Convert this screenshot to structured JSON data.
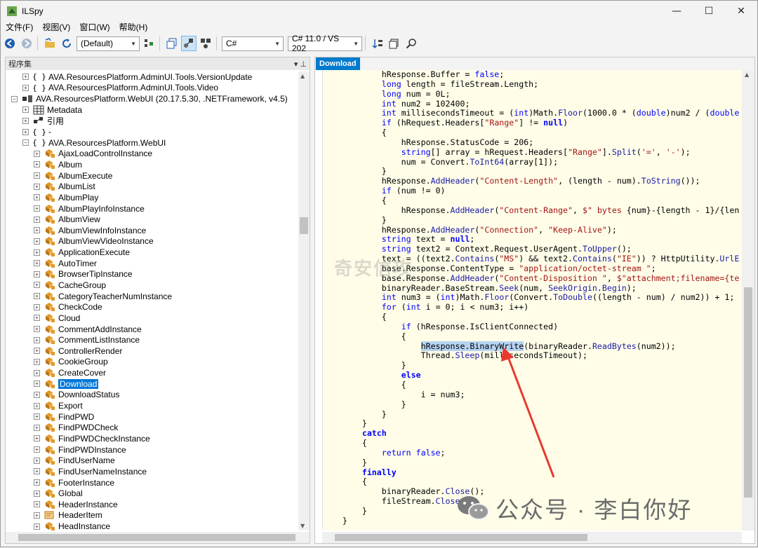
{
  "window": {
    "title": "ILSpy",
    "controls": [
      "—",
      "☐",
      "✕"
    ]
  },
  "menu": [
    "文件(F)",
    "视图(V)",
    "窗口(W)",
    "帮助(H)"
  ],
  "toolbar": {
    "assembly_list": "(Default)",
    "language": "C#",
    "version": "C# 11.0 / VS 202"
  },
  "left_pane": {
    "header": "程序集",
    "pin": "▾ ⊥"
  },
  "tree": [
    {
      "indent": 1,
      "expander": "+",
      "icon": "ns",
      "label": "AVA.ResourcesPlatform.AdminUI.Tools.VersionUpdate"
    },
    {
      "indent": 1,
      "expander": "+",
      "icon": "ns",
      "label": "AVA.ResourcesPlatform.AdminUI.Tools.Video"
    },
    {
      "indent": 0,
      "expander": "−",
      "icon": "asm",
      "label": "AVA.ResourcesPlatform.WebUI (20.17.5.30, .NETFramework, v4.5)"
    },
    {
      "indent": 1,
      "expander": "+",
      "icon": "meta",
      "label": "Metadata"
    },
    {
      "indent": 1,
      "expander": "+",
      "icon": "ref",
      "label": "引用"
    },
    {
      "indent": 1,
      "expander": "+",
      "icon": "ns",
      "label": "-"
    },
    {
      "indent": 1,
      "expander": "−",
      "icon": "ns",
      "label": "AVA.ResourcesPlatform.WebUI"
    },
    {
      "indent": 2,
      "expander": "+",
      "icon": "cls",
      "label": "AjaxLoadControlInstance"
    },
    {
      "indent": 2,
      "expander": "+",
      "icon": "cls",
      "label": "Album"
    },
    {
      "indent": 2,
      "expander": "+",
      "icon": "cls",
      "label": "AlbumExecute"
    },
    {
      "indent": 2,
      "expander": "+",
      "icon": "cls",
      "label": "AlbumList"
    },
    {
      "indent": 2,
      "expander": "+",
      "icon": "cls",
      "label": "AlbumPlay"
    },
    {
      "indent": 2,
      "expander": "+",
      "icon": "cls",
      "label": "AlbumPlayInfoInstance"
    },
    {
      "indent": 2,
      "expander": "+",
      "icon": "cls",
      "label": "AlbumView"
    },
    {
      "indent": 2,
      "expander": "+",
      "icon": "cls",
      "label": "AlbumViewInfoInstance"
    },
    {
      "indent": 2,
      "expander": "+",
      "icon": "cls",
      "label": "AlbumViewVideoInstance"
    },
    {
      "indent": 2,
      "expander": "+",
      "icon": "cls",
      "label": "ApplicationExecute"
    },
    {
      "indent": 2,
      "expander": "+",
      "icon": "cls",
      "label": "AutoTimer"
    },
    {
      "indent": 2,
      "expander": "+",
      "icon": "cls",
      "label": "BrowserTipInstance"
    },
    {
      "indent": 2,
      "expander": "+",
      "icon": "cls",
      "label": "CacheGroup"
    },
    {
      "indent": 2,
      "expander": "+",
      "icon": "cls",
      "label": "CategoryTeacherNumInstance"
    },
    {
      "indent": 2,
      "expander": "+",
      "icon": "cls",
      "label": "CheckCode"
    },
    {
      "indent": 2,
      "expander": "+",
      "icon": "cls",
      "label": "Cloud"
    },
    {
      "indent": 2,
      "expander": "+",
      "icon": "cls",
      "label": "CommentAddInstance"
    },
    {
      "indent": 2,
      "expander": "+",
      "icon": "cls",
      "label": "CommentListInstance"
    },
    {
      "indent": 2,
      "expander": "+",
      "icon": "cls",
      "label": "ControllerRender"
    },
    {
      "indent": 2,
      "expander": "+",
      "icon": "cls",
      "label": "CookieGroup"
    },
    {
      "indent": 2,
      "expander": "+",
      "icon": "cls",
      "label": "CreateCover"
    },
    {
      "indent": 2,
      "expander": "+",
      "icon": "cls",
      "label": "Download",
      "selected": true
    },
    {
      "indent": 2,
      "expander": "+",
      "icon": "cls",
      "label": "DownloadStatus"
    },
    {
      "indent": 2,
      "expander": "+",
      "icon": "cls",
      "label": "Export"
    },
    {
      "indent": 2,
      "expander": "+",
      "icon": "cls",
      "label": "FindPWD"
    },
    {
      "indent": 2,
      "expander": "+",
      "icon": "cls",
      "label": "FindPWDCheck"
    },
    {
      "indent": 2,
      "expander": "+",
      "icon": "cls",
      "label": "FindPWDCheckInstance"
    },
    {
      "indent": 2,
      "expander": "+",
      "icon": "cls",
      "label": "FindPWDInstance"
    },
    {
      "indent": 2,
      "expander": "+",
      "icon": "cls",
      "label": "FindUserName"
    },
    {
      "indent": 2,
      "expander": "+",
      "icon": "cls",
      "label": "FindUserNameInstance"
    },
    {
      "indent": 2,
      "expander": "+",
      "icon": "cls",
      "label": "FooterInstance"
    },
    {
      "indent": 2,
      "expander": "+",
      "icon": "cls",
      "label": "Global"
    },
    {
      "indent": 2,
      "expander": "+",
      "icon": "cls",
      "label": "HeaderInstance"
    },
    {
      "indent": 2,
      "expander": "+",
      "icon": "item",
      "label": "HeaderItem"
    },
    {
      "indent": 2,
      "expander": "+",
      "icon": "cls",
      "label": "HeadInstance"
    }
  ],
  "editor": {
    "tab": "Download",
    "lines": [
      [
        [
          "            hResponse.Buffer = ",
          ""
        ],
        [
          "false",
          "kw"
        ],
        [
          ";",
          ""
        ]
      ],
      [
        [
          "            ",
          ""
        ],
        [
          "long",
          "kw"
        ],
        [
          " length = fileStream.Length;",
          ""
        ]
      ],
      [
        [
          "            ",
          ""
        ],
        [
          "long",
          "kw"
        ],
        [
          " num = 0L;",
          ""
        ]
      ],
      [
        [
          "            ",
          ""
        ],
        [
          "int",
          "kw"
        ],
        [
          " num2 = 102400;",
          ""
        ]
      ],
      [
        [
          "            ",
          ""
        ],
        [
          "int",
          "kw"
        ],
        [
          " millisecondsTimeout = (",
          ""
        ],
        [
          "int",
          "kw"
        ],
        [
          ")Math.",
          ""
        ],
        [
          "Floor",
          "mth"
        ],
        [
          "(1000.0 * (",
          ""
        ],
        [
          "double",
          "kw"
        ],
        [
          ")num2 / (",
          ""
        ],
        [
          "double",
          "kw"
        ]
      ],
      [
        [
          "            ",
          ""
        ],
        [
          "if",
          "kw"
        ],
        [
          " (hRequest.Headers[",
          ""
        ],
        [
          "\"Range\"",
          "str"
        ],
        [
          "] != ",
          ""
        ],
        [
          "null",
          "kwb"
        ],
        [
          ")",
          ""
        ]
      ],
      [
        [
          "            {",
          ""
        ]
      ],
      [
        [
          "                hResponse.StatusCode = 206;",
          ""
        ]
      ],
      [
        [
          "                ",
          ""
        ],
        [
          "string",
          "kw"
        ],
        [
          "[] array = hRequest.Headers[",
          ""
        ],
        [
          "\"Range\"",
          "str"
        ],
        [
          "].",
          ""
        ],
        [
          "Split",
          "mth"
        ],
        [
          "(",
          ""
        ],
        [
          "'='",
          "str"
        ],
        [
          ", ",
          ""
        ],
        [
          "'-'",
          "str"
        ],
        [
          ");",
          ""
        ]
      ],
      [
        [
          "                num = Convert.",
          ""
        ],
        [
          "ToInt64",
          "mth"
        ],
        [
          "(array[1]);",
          ""
        ]
      ],
      [
        [
          "            }",
          ""
        ]
      ],
      [
        [
          "            hResponse.",
          ""
        ],
        [
          "AddHeader",
          "mth"
        ],
        [
          "(",
          ""
        ],
        [
          "\"Content-Length\"",
          "str"
        ],
        [
          ", (length - num).",
          ""
        ],
        [
          "ToString",
          "mth"
        ],
        [
          "());",
          ""
        ]
      ],
      [
        [
          "            ",
          ""
        ],
        [
          "if",
          "kw"
        ],
        [
          " (num != 0)",
          ""
        ]
      ],
      [
        [
          "            {",
          ""
        ]
      ],
      [
        [
          "                hResponse.",
          ""
        ],
        [
          "AddHeader",
          "mth"
        ],
        [
          "(",
          ""
        ],
        [
          "\"Content-Range\"",
          "str"
        ],
        [
          ", ",
          ""
        ],
        [
          "$\" bytes ",
          "str"
        ],
        [
          "{num}-{length - 1}/{len",
          ""
        ]
      ],
      [
        [
          "            }",
          ""
        ]
      ],
      [
        [
          "            hResponse.",
          ""
        ],
        [
          "AddHeader",
          "mth"
        ],
        [
          "(",
          ""
        ],
        [
          "\"Connection\"",
          "str"
        ],
        [
          ", ",
          ""
        ],
        [
          "\"Keep-Alive\"",
          "str"
        ],
        [
          ");",
          ""
        ]
      ],
      [
        [
          "            ",
          ""
        ],
        [
          "string",
          "kw"
        ],
        [
          " text = ",
          ""
        ],
        [
          "null",
          "kwb"
        ],
        [
          ";",
          ""
        ]
      ],
      [
        [
          "            ",
          ""
        ],
        [
          "string",
          "kw"
        ],
        [
          " text2 = Context.Request.UserAgent.",
          ""
        ],
        [
          "ToUpper",
          "mth"
        ],
        [
          "();",
          ""
        ]
      ],
      [
        [
          "            text = ((text2.",
          ""
        ],
        [
          "Contains",
          "mth"
        ],
        [
          "(",
          ""
        ],
        [
          "\"MS\"",
          "str"
        ],
        [
          ") && text2.",
          ""
        ],
        [
          "Contains",
          "mth"
        ],
        [
          "(",
          ""
        ],
        [
          "\"IE\"",
          "str"
        ],
        [
          ")) ? HttpUtility.",
          ""
        ],
        [
          "UrlE",
          "mth"
        ]
      ],
      [
        [
          "            base.Response.ContentType = ",
          ""
        ],
        [
          "\"application/octet-stream \"",
          "str"
        ],
        [
          ";",
          ""
        ]
      ],
      [
        [
          "            base.Response.",
          ""
        ],
        [
          "AddHeader",
          "mth"
        ],
        [
          "(",
          ""
        ],
        [
          "\"Content-Disposition \"",
          "str"
        ],
        [
          ", ",
          ""
        ],
        [
          "$\"attachment;filename={te",
          "str"
        ]
      ],
      [
        [
          "            binaryReader.BaseStream.",
          ""
        ],
        [
          "Seek",
          "mth"
        ],
        [
          "(num, ",
          ""
        ],
        [
          "SeekOrigin",
          "mth"
        ],
        [
          ".",
          ""
        ],
        [
          "Begin",
          "mth"
        ],
        [
          ");",
          ""
        ]
      ],
      [
        [
          "            ",
          ""
        ],
        [
          "int",
          "kw"
        ],
        [
          " num3 = (",
          ""
        ],
        [
          "int",
          "kw"
        ],
        [
          ")Math.",
          ""
        ],
        [
          "Floor",
          "mth"
        ],
        [
          "(Convert.",
          ""
        ],
        [
          "ToDouble",
          "mth"
        ],
        [
          "((length - num) / num2)) + 1;",
          ""
        ]
      ],
      [
        [
          "            ",
          ""
        ],
        [
          "for",
          "kw"
        ],
        [
          " (",
          ""
        ],
        [
          "int",
          "kw"
        ],
        [
          " i = 0; i < num3; i++)",
          ""
        ]
      ],
      [
        [
          "            {",
          ""
        ]
      ],
      [
        [
          "                ",
          ""
        ],
        [
          "if",
          "kw"
        ],
        [
          " (hResponse.IsClientConnected)",
          ""
        ]
      ],
      [
        [
          "                {",
          ""
        ]
      ],
      [
        [
          "                    ",
          ""
        ],
        [
          "hResponse.BinaryWrite",
          "hlm"
        ],
        [
          "(binaryReader.",
          ""
        ],
        [
          "ReadBytes",
          "mth"
        ],
        [
          "(num2));",
          ""
        ]
      ],
      [
        [
          "                    Thread.",
          ""
        ],
        [
          "Sleep",
          "mth"
        ],
        [
          "(millisecondsTimeout);",
          ""
        ]
      ],
      [
        [
          "                }",
          ""
        ]
      ],
      [
        [
          "                ",
          ""
        ],
        [
          "else",
          "kwb"
        ]
      ],
      [
        [
          "                {",
          ""
        ]
      ],
      [
        [
          "                    i = num3;",
          ""
        ]
      ],
      [
        [
          "                }",
          ""
        ]
      ],
      [
        [
          "            }",
          ""
        ]
      ],
      [
        [
          "        }",
          ""
        ]
      ],
      [
        [
          "        ",
          ""
        ],
        [
          "catch",
          "kwb"
        ]
      ],
      [
        [
          "        {",
          ""
        ]
      ],
      [
        [
          "            ",
          ""
        ],
        [
          "return",
          "kw"
        ],
        [
          " ",
          ""
        ],
        [
          "false",
          "kw"
        ],
        [
          ";",
          ""
        ]
      ],
      [
        [
          "        }",
          ""
        ]
      ],
      [
        [
          "        ",
          ""
        ],
        [
          "finally",
          "kwb"
        ]
      ],
      [
        [
          "        {",
          ""
        ]
      ],
      [
        [
          "            binaryReader.",
          ""
        ],
        [
          "Close",
          "mth"
        ],
        [
          "();",
          ""
        ]
      ],
      [
        [
          "            fileStream.",
          ""
        ],
        [
          "Close",
          "mth"
        ],
        [
          "();",
          ""
        ]
      ],
      [
        [
          "        }",
          ""
        ]
      ],
      [
        [
          "    }",
          ""
        ]
      ]
    ]
  },
  "overlay": {
    "watermark": "奇安信攻",
    "footer": "公众号 · 李白你好",
    "arrow_color": "#e8392d"
  }
}
